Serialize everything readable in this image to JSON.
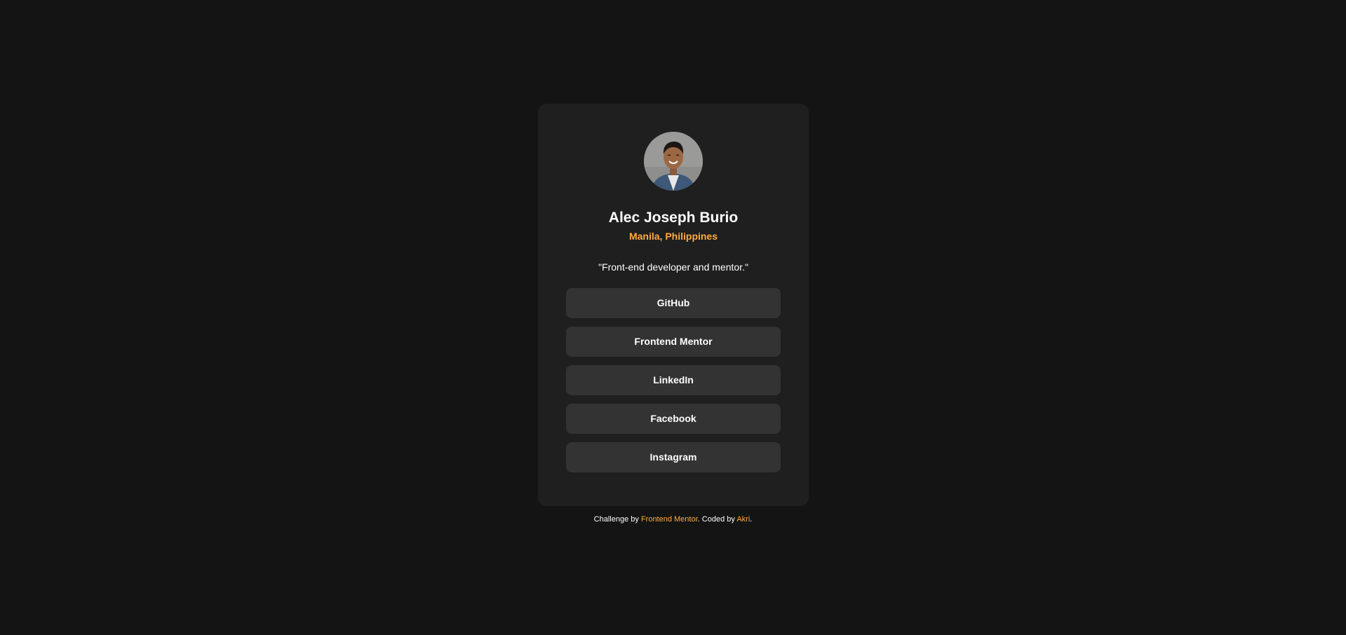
{
  "profile": {
    "avatar_icon": "profile-photo",
    "name": "Alec Joseph Burio",
    "location": "Manila, Philippines",
    "bio": "\"Front-end developer and mentor.\""
  },
  "links": [
    {
      "label": "GitHub"
    },
    {
      "label": "Frontend Mentor"
    },
    {
      "label": "LinkedIn"
    },
    {
      "label": "Facebook"
    },
    {
      "label": "Instagram"
    }
  ],
  "footer": {
    "prefix": "Challenge by ",
    "challenge_link": "Frontend Mentor",
    "middle": ". Coded by ",
    "author_link": "Akri",
    "suffix": "."
  },
  "colors": {
    "page_background": "#141414",
    "card_background": "#1f1f1f",
    "button_background": "#333333",
    "accent": "#ffab40",
    "text": "#ffffff"
  }
}
